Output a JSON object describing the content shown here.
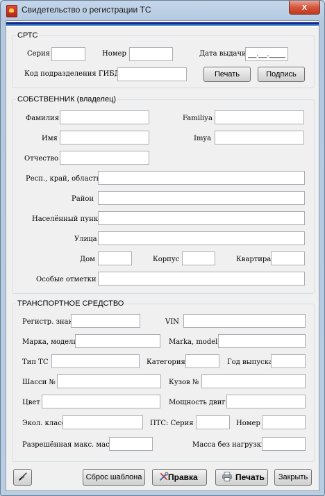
{
  "window": {
    "title": "Свидетельство о регистрации ТС",
    "close_label": "x"
  },
  "srts": {
    "legend": "СРТС",
    "series_label": "Серия",
    "series_value": "",
    "number_label": "Номер",
    "number_value": "",
    "issue_date_label": "Дата выдачи",
    "issue_date_value": "__.__.____",
    "gibdd_label": "Код подразделения ГИБДД",
    "gibdd_value": "",
    "print_label": "Печать",
    "sign_label": "Подпись"
  },
  "owner": {
    "legend": "СОБСТВЕННИК (владелец)",
    "surname_label": "Фамилия",
    "surname_latin_label": "Familiya",
    "name_label": "Имя",
    "name_latin_label": "Imya",
    "patronymic_label": "Отчество",
    "region_label": "Респ., край, область",
    "district_label": "Район",
    "locality_label": "Населённый пункт",
    "street_label": "Улица",
    "house_label": "Дом",
    "building_label": "Корпус",
    "apartment_label": "Квартира",
    "notes_label": "Особые отметки"
  },
  "vehicle": {
    "legend": "ТРАНСПОРТНОЕ СРЕДСТВО",
    "reg_plate_label": "Регистр. знак",
    "vin_label": "VIN",
    "make_model_label": "Марка, модель",
    "make_model_latin_label": "Marka, model'",
    "type_label": "Тип ТС",
    "category_label": "Категория",
    "year_label": "Год выпуска",
    "chassis_label": "Шасси №",
    "body_label": "Кузов №",
    "color_label": "Цвет",
    "power_label": "Мощность двиг.",
    "eco_label": "Экол. класс",
    "pts_series_label": "ПТС:  Серия",
    "pts_number_label": "Номер",
    "max_mass_label": "Разрешённая макс. масса",
    "unladen_mass_label": "Масса без нагрузки"
  },
  "footer": {
    "reset_label": "Сброс шаблона",
    "edit_label": "Правка",
    "print_label": "Печать",
    "close_label": "Закрыть"
  },
  "colors": {
    "accent_blue": "#1b2a8a",
    "close_red": "#c0391f"
  },
  "icons": {
    "tool": "brush-icon",
    "edit": "tools-icon",
    "print": "printer-icon"
  }
}
